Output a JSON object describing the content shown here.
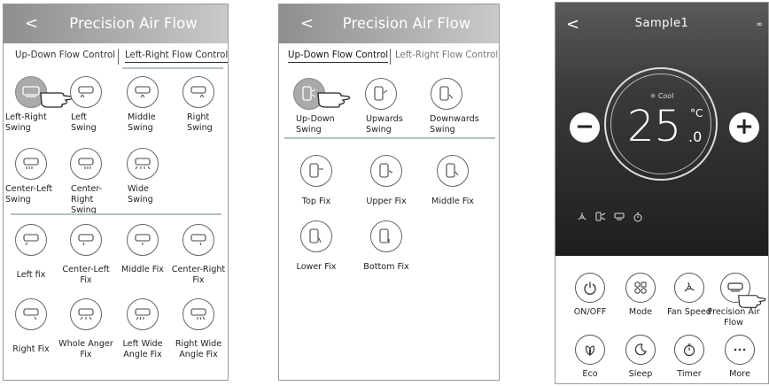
{
  "screen1": {
    "back": "<",
    "title": "Precision Air Flow",
    "tabs": [
      "Up-Down Flow Control",
      "Left-Right Flow Control"
    ],
    "swing_items": [
      "Left-Right Swing",
      "Left Swing",
      "Middle Swing",
      "Right Swing",
      "Center-Left Swing",
      "Center-Right Swing",
      "Wide Swing"
    ],
    "fix_items": [
      "Left fix",
      "Center-Left Fix",
      "Middle Fix",
      "Center-Right Fix",
      "Right Fix",
      "Whole Anger Fix",
      "Left Wide Angle Fix",
      "Right Wide Angle Fix"
    ]
  },
  "screen2": {
    "back": "<",
    "title": "Precision Air Flow",
    "tabs": [
      "Up-Down Flow Control",
      "Left-Right Flow Control"
    ],
    "swing_items": [
      "Up-Down Swing",
      "Upwards Swing",
      "Downwards Swing"
    ],
    "fix_items": [
      "Top Fix",
      "Upper Fix",
      "Middle Fix",
      "Lower Fix",
      "Bottom Fix"
    ]
  },
  "screen3": {
    "back": "<",
    "title": "Sample1",
    "link": "∞",
    "mode": "Cool",
    "temp": "25",
    "unit": "°C",
    "decimal": ".0",
    "minus": "−",
    "plus": "+",
    "buttons": [
      "ON/OFF",
      "Mode",
      "Fan Speed",
      "Precision Air Flow",
      "Eco",
      "Sleep",
      "Timer",
      "More"
    ]
  },
  "colors": {
    "selected": "#aaaaaa",
    "header_gradient_start": "#8e8e8e",
    "divider": "#b5c0c2"
  }
}
